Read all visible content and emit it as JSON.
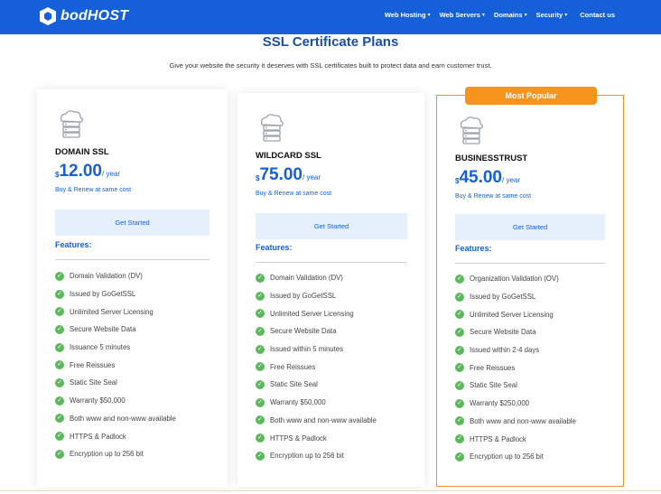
{
  "header": {
    "logo_text": "bodHOST",
    "nav": [
      {
        "label": "Web Hosting",
        "caret": true
      },
      {
        "label": "Web Servers",
        "caret": true
      },
      {
        "label": "Domains",
        "caret": true
      },
      {
        "label": "Security",
        "caret": true
      },
      {
        "label": "Contact us",
        "caret": false
      }
    ],
    "colors": {
      "bar": "#1560d8"
    }
  },
  "section": {
    "title": "SSL Certificate Plans",
    "subtitle": "Give your website the security it deserves with SSL certificates built to protect data and earn customer trust."
  },
  "plans": [
    {
      "name": "DOMAIN SSL",
      "currency": "$",
      "price": "12.00",
      "per": "/ year",
      "renew": "Buy & Renew at same cost",
      "button": "Get Started",
      "features_title": "Features:",
      "icon": "cloud-server-icon",
      "features": [
        "Domain Validation (DV)",
        "Issued by GoGetSSL",
        "Unlimited Server Licensing",
        "Secure Website Data",
        "Issuance 5 minutes",
        "Free Reissues",
        "Static Site Seal",
        "Warranty $50,000",
        "Both www and non-www available",
        "HTTPS & Padlock",
        "Encryption up to 256 bit"
      ]
    },
    {
      "name": "WILDCARD SSL",
      "currency": "$",
      "price": "75.00",
      "per": "/ year",
      "renew": "Buy & Renew at same cost",
      "button": "Get Started",
      "features_title": "Features:",
      "icon": "cloud-server-icon",
      "features": [
        "Domain Validation (DV)",
        "Issued by GoGetSSL",
        "Unlimited Server Licensing",
        "Secure Website Data",
        "Issued within 5 minutes",
        "Free Reissues",
        "Static Site Seal",
        "Warranty $50,000",
        "Both www and non-www available",
        "HTTPS & Padlock",
        "Encryption up to 256 bit"
      ]
    },
    {
      "name": "BUSINESSTRUST",
      "badge": "Most Popular",
      "currency": "$",
      "price": "45.00",
      "per": "/ year",
      "renew": "Buy & Renew at same cost",
      "button": "Get Started",
      "features_title": "Features:",
      "icon": "cloud-server-icon",
      "features": [
        "Organization Validation (OV)",
        "Issued by GoGetSSL",
        "Unlimited Server Licensing",
        "Secure Website Data",
        "Issued within 2-4 days",
        "Free Reissues",
        "Static Site Seal",
        "Warranty $250,000",
        "Both www and non-www available",
        "HTTPS & Padlock",
        "Encryption up to 256 bit"
      ]
    }
  ],
  "colors": {
    "accent": "#1560d8",
    "badge": "#f7941d",
    "check": "#5cb85c"
  }
}
